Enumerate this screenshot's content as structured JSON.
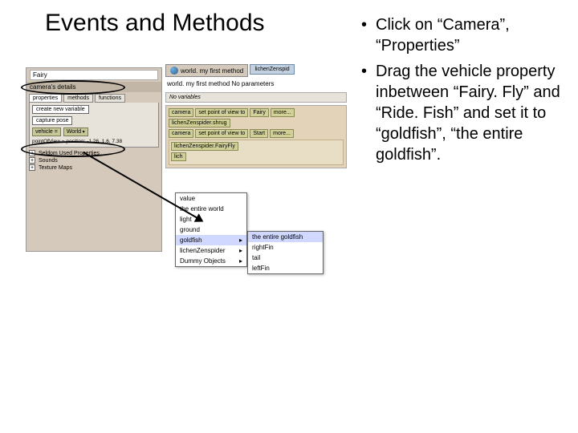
{
  "title": "Events and Methods",
  "bullets": [
    "Click on “Camera”, “Properties”",
    "Drag the vehicle property inbetween “Fairy. Fly” and “Ride. Fish” and set it to “goldfish”, “the entire goldfish”."
  ],
  "screenshot": {
    "tree_item": "Fairy",
    "details_title": "camera's details",
    "tabs": [
      "properties",
      "methods",
      "functions"
    ],
    "active_tab": 0,
    "buttons": {
      "create_var": "create new variable",
      "capture_pose": "capture pose"
    },
    "vehicle_prop": {
      "label": "vehicle =",
      "value": "World"
    },
    "point_of_view": "pointOfView = position: -1.26, 1.6, 7.38",
    "expanders": [
      "Seldom Used Properties",
      "Sounds",
      "Texture Maps"
    ],
    "editor": {
      "tab1": "world. my first method",
      "tab2": "lichenZenspid",
      "header": "world. my first method  No parameters",
      "no_vars": "No variables",
      "rows": [
        [
          "camera",
          "set point of view to",
          "Fairy",
          "more..."
        ],
        [
          "lichenZenspider.shrug"
        ],
        [
          "camera",
          "set point of view to",
          "Start",
          "more..."
        ]
      ],
      "nested_rows": [
        "lichenZenspider.FairyFly",
        "lich"
      ]
    },
    "popup": {
      "items": [
        "value",
        "the entire world",
        "light",
        "ground",
        "goldfish",
        "lichenZenspider",
        "Dummy Objects"
      ],
      "selected": 4,
      "submenu_parents": [
        4,
        5,
        6
      ]
    },
    "subpopup": {
      "items": [
        "the entire goldfish",
        "rightFin",
        "tail",
        "leftFin"
      ],
      "selected": 0
    }
  }
}
